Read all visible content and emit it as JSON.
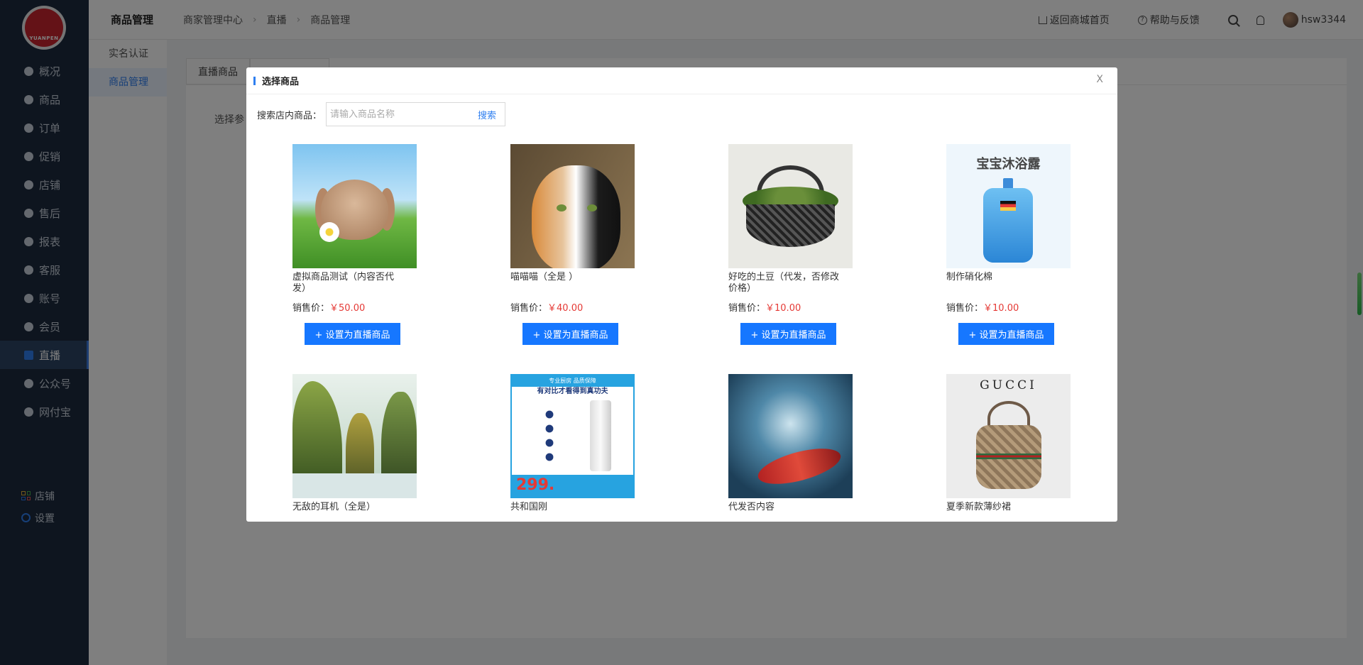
{
  "brand": {
    "logo_text": "YUANPEN"
  },
  "sidebar": {
    "items": [
      {
        "label": "概况",
        "icon": "dashboard-icon",
        "active": false
      },
      {
        "label": "商品",
        "icon": "bag-icon",
        "active": false
      },
      {
        "label": "订单",
        "icon": "chart-bar-icon",
        "active": false
      },
      {
        "label": "促销",
        "icon": "promo-icon",
        "active": false
      },
      {
        "label": "店铺",
        "icon": "store-icon",
        "active": false
      },
      {
        "label": "售后",
        "icon": "after-sales-icon",
        "active": false
      },
      {
        "label": "报表",
        "icon": "report-icon",
        "active": false
      },
      {
        "label": "客服",
        "icon": "service-icon",
        "active": false
      },
      {
        "label": "账号",
        "icon": "account-icon",
        "active": false
      },
      {
        "label": "会员",
        "icon": "diamond-icon",
        "active": false
      },
      {
        "label": "直播",
        "icon": "live-icon",
        "active": true
      },
      {
        "label": "公众号",
        "icon": "check-circle-icon",
        "active": false
      },
      {
        "label": "网付宝",
        "icon": "shield-icon",
        "active": false
      }
    ],
    "bottom": [
      {
        "label": "店铺",
        "icon": "grid-icon"
      },
      {
        "label": "设置",
        "icon": "settings-icon"
      }
    ]
  },
  "subnav": {
    "items": [
      {
        "label": "实名认证",
        "active": false
      },
      {
        "label": "商品管理",
        "active": true
      }
    ]
  },
  "header": {
    "module_title": "商品管理",
    "breadcrumb": [
      "商家管理中心",
      "直播",
      "商品管理"
    ],
    "back_home": "返回商城首页",
    "help": "帮助与反馈",
    "username": "hsw3344"
  },
  "main": {
    "tabs": [
      "直播商品",
      ""
    ],
    "select_label": "选择参"
  },
  "modal": {
    "title": "选择商品",
    "close": "X",
    "search_label": "搜索店内商品：",
    "search_placeholder": "请输入商品名称",
    "search_value": "",
    "search_button": "搜索",
    "price_label": "销售价：",
    "add_button": "+ 设置为直播商品",
    "products": [
      {
        "name": "虚拟商品测试（内容否代发）",
        "price": "￥50.00",
        "image": "rabbit"
      },
      {
        "name": "喵喵喵（全是 ）",
        "price": "￥40.00",
        "image": "cat"
      },
      {
        "name": "好吃的土豆（代发，否修改价格）",
        "price": "￥10.00",
        "image": "basket"
      },
      {
        "name": "制作硝化棉",
        "price": "￥10.00",
        "image": "bottle",
        "image_text": "宝宝沐浴露"
      },
      {
        "name": "无敌的耳机（全是）",
        "price": "",
        "image": "mountain"
      },
      {
        "name": "共和国刚",
        "price": "",
        "image": "poster",
        "image_text_top": "专业厨房 品质保障",
        "image_text_sub": "有对比才看得到真功夫",
        "image_price": "299."
      },
      {
        "name": "代发否内容",
        "price": "",
        "image": "ocean"
      },
      {
        "name": "夏季新款薄纱裙",
        "price": "",
        "image": "bag",
        "image_text": "GUCCI"
      }
    ]
  }
}
